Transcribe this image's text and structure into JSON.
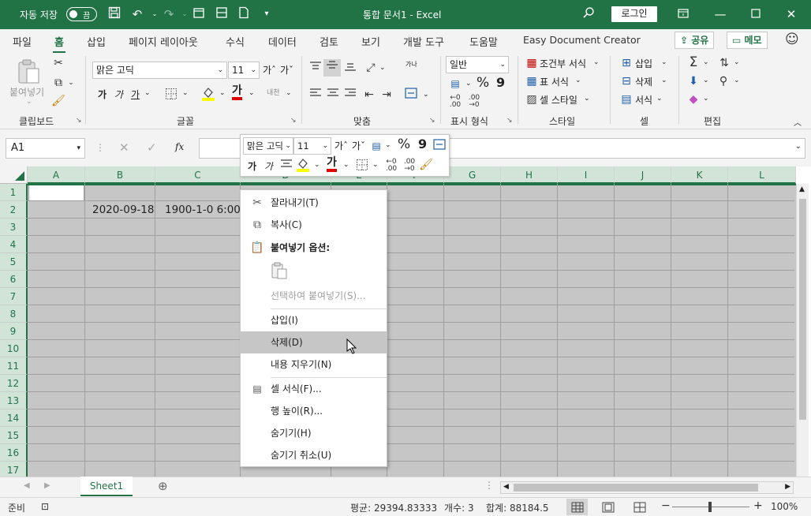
{
  "titlebar": {
    "autosave_label": "자동 저장",
    "autosave_state": "끔",
    "doc_title": "통합 문서1  -  Excel",
    "login_label": "로그인"
  },
  "tabs": [
    "파일",
    "홈",
    "삽입",
    "페이지 레이아웃",
    "수식",
    "데이터",
    "검토",
    "보기",
    "개발 도구",
    "도움말",
    "Easy Document Creator"
  ],
  "tabs_active": "홈",
  "share_label": "공유",
  "memo_label": "메모",
  "ribbon": {
    "clipboard": {
      "label": "클립보드",
      "paste": "붙여넣기"
    },
    "font": {
      "label": "글꼴",
      "name": "맑은 고딕",
      "size": "11",
      "bold": "가",
      "italic": "가",
      "underline": "가",
      "grow": "가",
      "shrink": "가",
      "color_letter": "가",
      "phonetic": "내천"
    },
    "alignment": {
      "label": "맞춤",
      "wrap": "가나"
    },
    "number": {
      "label": "표시 형식",
      "format": "일반",
      "percent": "%",
      "comma": "9"
    },
    "styles": {
      "label": "스타일",
      "conditional": "조건부 서식",
      "table": "표 서식",
      "cell": "셀 스타일"
    },
    "cells": {
      "label": "셀",
      "insert": "삽입",
      "delete": "삭제",
      "format": "서식"
    },
    "editing": {
      "label": "편집"
    }
  },
  "formula_bar": {
    "namebox": "A1",
    "fx": "fx",
    "value": ""
  },
  "columns": [
    "A",
    "B",
    "C",
    "D",
    "E",
    "F",
    "G",
    "H",
    "I",
    "J",
    "K",
    "L"
  ],
  "rows": [
    "1",
    "2",
    "3",
    "4",
    "5",
    "6",
    "7",
    "8",
    "9",
    "10",
    "11",
    "12",
    "13",
    "14",
    "15",
    "16",
    "17"
  ],
  "cells": {
    "B2": "2020-09-18",
    "C2": "1900-1-0 6:00"
  },
  "mini_toolbar": {
    "font": "맑은 고딕",
    "size": "11",
    "bold": "가",
    "italic": "가",
    "color_letter": "가",
    "percent": "%",
    "comma": "9"
  },
  "context_menu": {
    "cut": "잘라내기(T)",
    "copy": "복사(C)",
    "paste_options": "붙여넣기 옵션:",
    "paste_special": "선택하여 붙여넣기(S)...",
    "insert": "삽입(I)",
    "delete": "삭제(D)",
    "clear": "내용 지우기(N)",
    "format_cells": "셀 서식(F)...",
    "row_height": "행 높이(R)...",
    "hide": "숨기기(H)",
    "unhide": "숨기기 취소(U)"
  },
  "sheet_tab": "Sheet1",
  "status": {
    "ready": "준비",
    "average": "평균: 29394.83333",
    "count": "개수: 3",
    "sum": "합계: 88184.5",
    "zoom": "100%"
  },
  "colors": {
    "accent": "#217346",
    "selection": "#c6c6c6"
  }
}
